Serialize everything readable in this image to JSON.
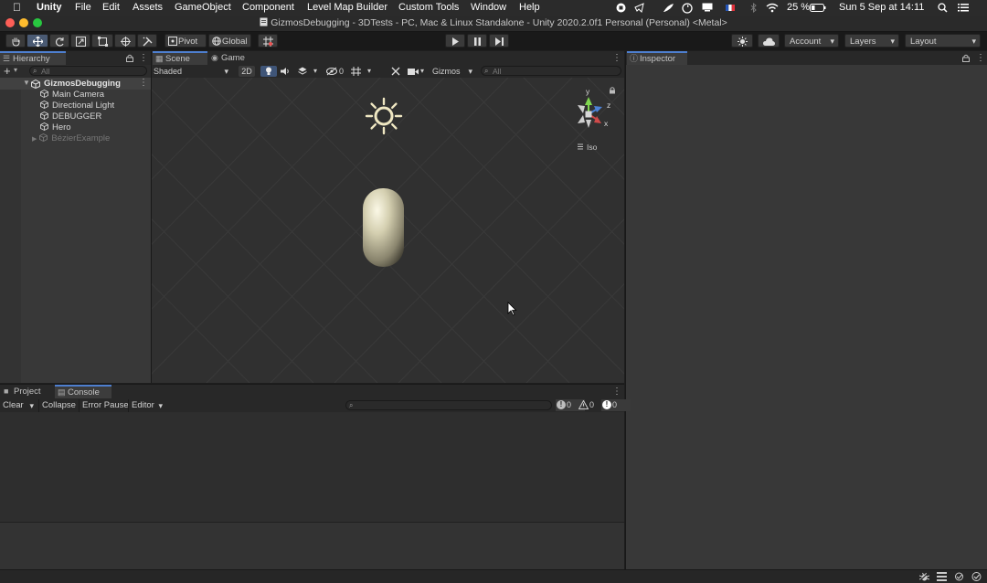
{
  "menubar": {
    "apple": "",
    "items": [
      "Unity",
      "File",
      "Edit",
      "Assets",
      "GameObject",
      "Component",
      "Level Map Builder",
      "Custom Tools",
      "Window",
      "Help"
    ],
    "battery": "25 %",
    "datetime": "Sun 5 Sep at  14:11"
  },
  "window": {
    "title": "GizmosDebugging - 3DTests - PC, Mac & Linux Standalone - Unity 2020.2.0f1 Personal (Personal) <Metal>"
  },
  "toolbar": {
    "pivot_label": "Pivot",
    "global_label": "Global",
    "account_label": "Account",
    "layers_label": "Layers",
    "layout_label": "Layout"
  },
  "hierarchy": {
    "tab_label": "Hierarchy",
    "search_placeholder": "All",
    "scene_name": "GizmosDebugging",
    "items": [
      {
        "label": "Main Camera",
        "enabled": true
      },
      {
        "label": "Directional Light",
        "enabled": true
      },
      {
        "label": "DEBUGGER",
        "enabled": true
      },
      {
        "label": "Hero",
        "enabled": true
      },
      {
        "label": "BézierExample",
        "enabled": false
      }
    ]
  },
  "scene": {
    "tabs": [
      "Scene",
      "Game"
    ],
    "shading_mode": "Shaded",
    "mode_2d": "2D",
    "hidden_count": "0",
    "gizmos_label": "Gizmos",
    "search_placeholder": "All",
    "gizmo_axes": {
      "y": "y",
      "z": "z",
      "x": "x"
    },
    "projection_label": "Iso"
  },
  "inspector": {
    "tab_label": "Inspector"
  },
  "console": {
    "tabs": [
      "Project",
      "Console"
    ],
    "clear_label": "Clear",
    "collapse_label": "Collapse",
    "error_pause_label": "Error Pause",
    "editor_label": "Editor",
    "info_count": "0",
    "warning_count": "0",
    "error_count": "0"
  },
  "colors": {
    "accent": "#4e7fcf",
    "panel": "#383838",
    "scene_bg": "#2f2f2f",
    "close": "#fe5f57",
    "minimize": "#febc2e",
    "maximize": "#28c840"
  }
}
